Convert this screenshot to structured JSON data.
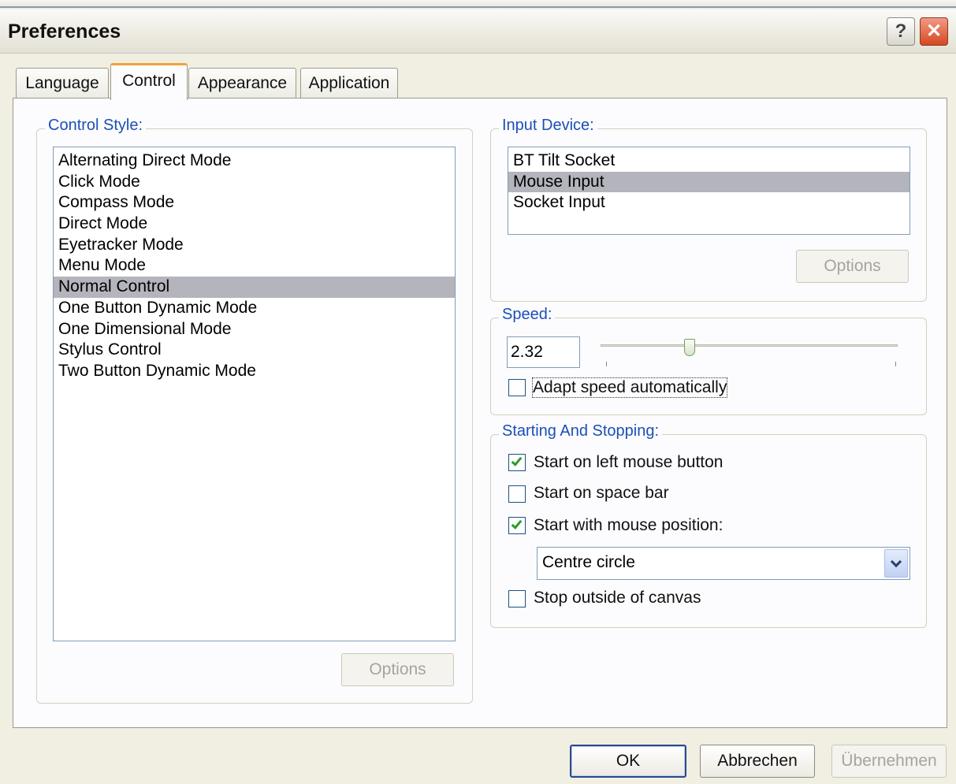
{
  "window": {
    "title": "Preferences",
    "help_glyph": "?",
    "close_glyph": "✕"
  },
  "tabs": [
    {
      "label": "Language"
    },
    {
      "label": "Control",
      "active": true
    },
    {
      "label": "Appearance"
    },
    {
      "label": "Application"
    }
  ],
  "control_style": {
    "title": "Control Style:",
    "items": [
      "Alternating Direct Mode",
      "Click Mode",
      "Compass Mode",
      "Direct Mode",
      "Eyetracker Mode",
      "Menu Mode",
      "Normal Control",
      "One Button Dynamic Mode",
      "One Dimensional Mode",
      "Stylus Control",
      "Two Button Dynamic Mode"
    ],
    "selected": "Normal Control",
    "options_label": "Options"
  },
  "input_device": {
    "title": "Input Device:",
    "items": [
      "BT Tilt Socket",
      "Mouse Input",
      "Socket Input"
    ],
    "selected": "Mouse Input",
    "options_label": "Options"
  },
  "speed": {
    "title": "Speed:",
    "value": "2.32",
    "slider_fraction": 0.3,
    "adapt_label": "Adapt speed automatically",
    "adapt_checked": false
  },
  "starting_stopping": {
    "title": "Starting And Stopping:",
    "start_left_mouse": {
      "label": "Start on left mouse button",
      "checked": true
    },
    "start_space_bar": {
      "label": "Start on space bar",
      "checked": false
    },
    "start_mouse_position": {
      "label": "Start with mouse position:",
      "checked": true
    },
    "position_select": "Centre circle",
    "stop_outside": {
      "label": "Stop outside of canvas",
      "checked": false
    }
  },
  "footer": {
    "ok_label": "OK",
    "cancel_label": "Abbrechen",
    "apply_label": "Übernehmen"
  },
  "colors": {
    "group_title": "#1b4fb5",
    "selection": "#b4b4bc",
    "active_tab_accent": "#f0a33a",
    "check": "#2d9b2d"
  }
}
